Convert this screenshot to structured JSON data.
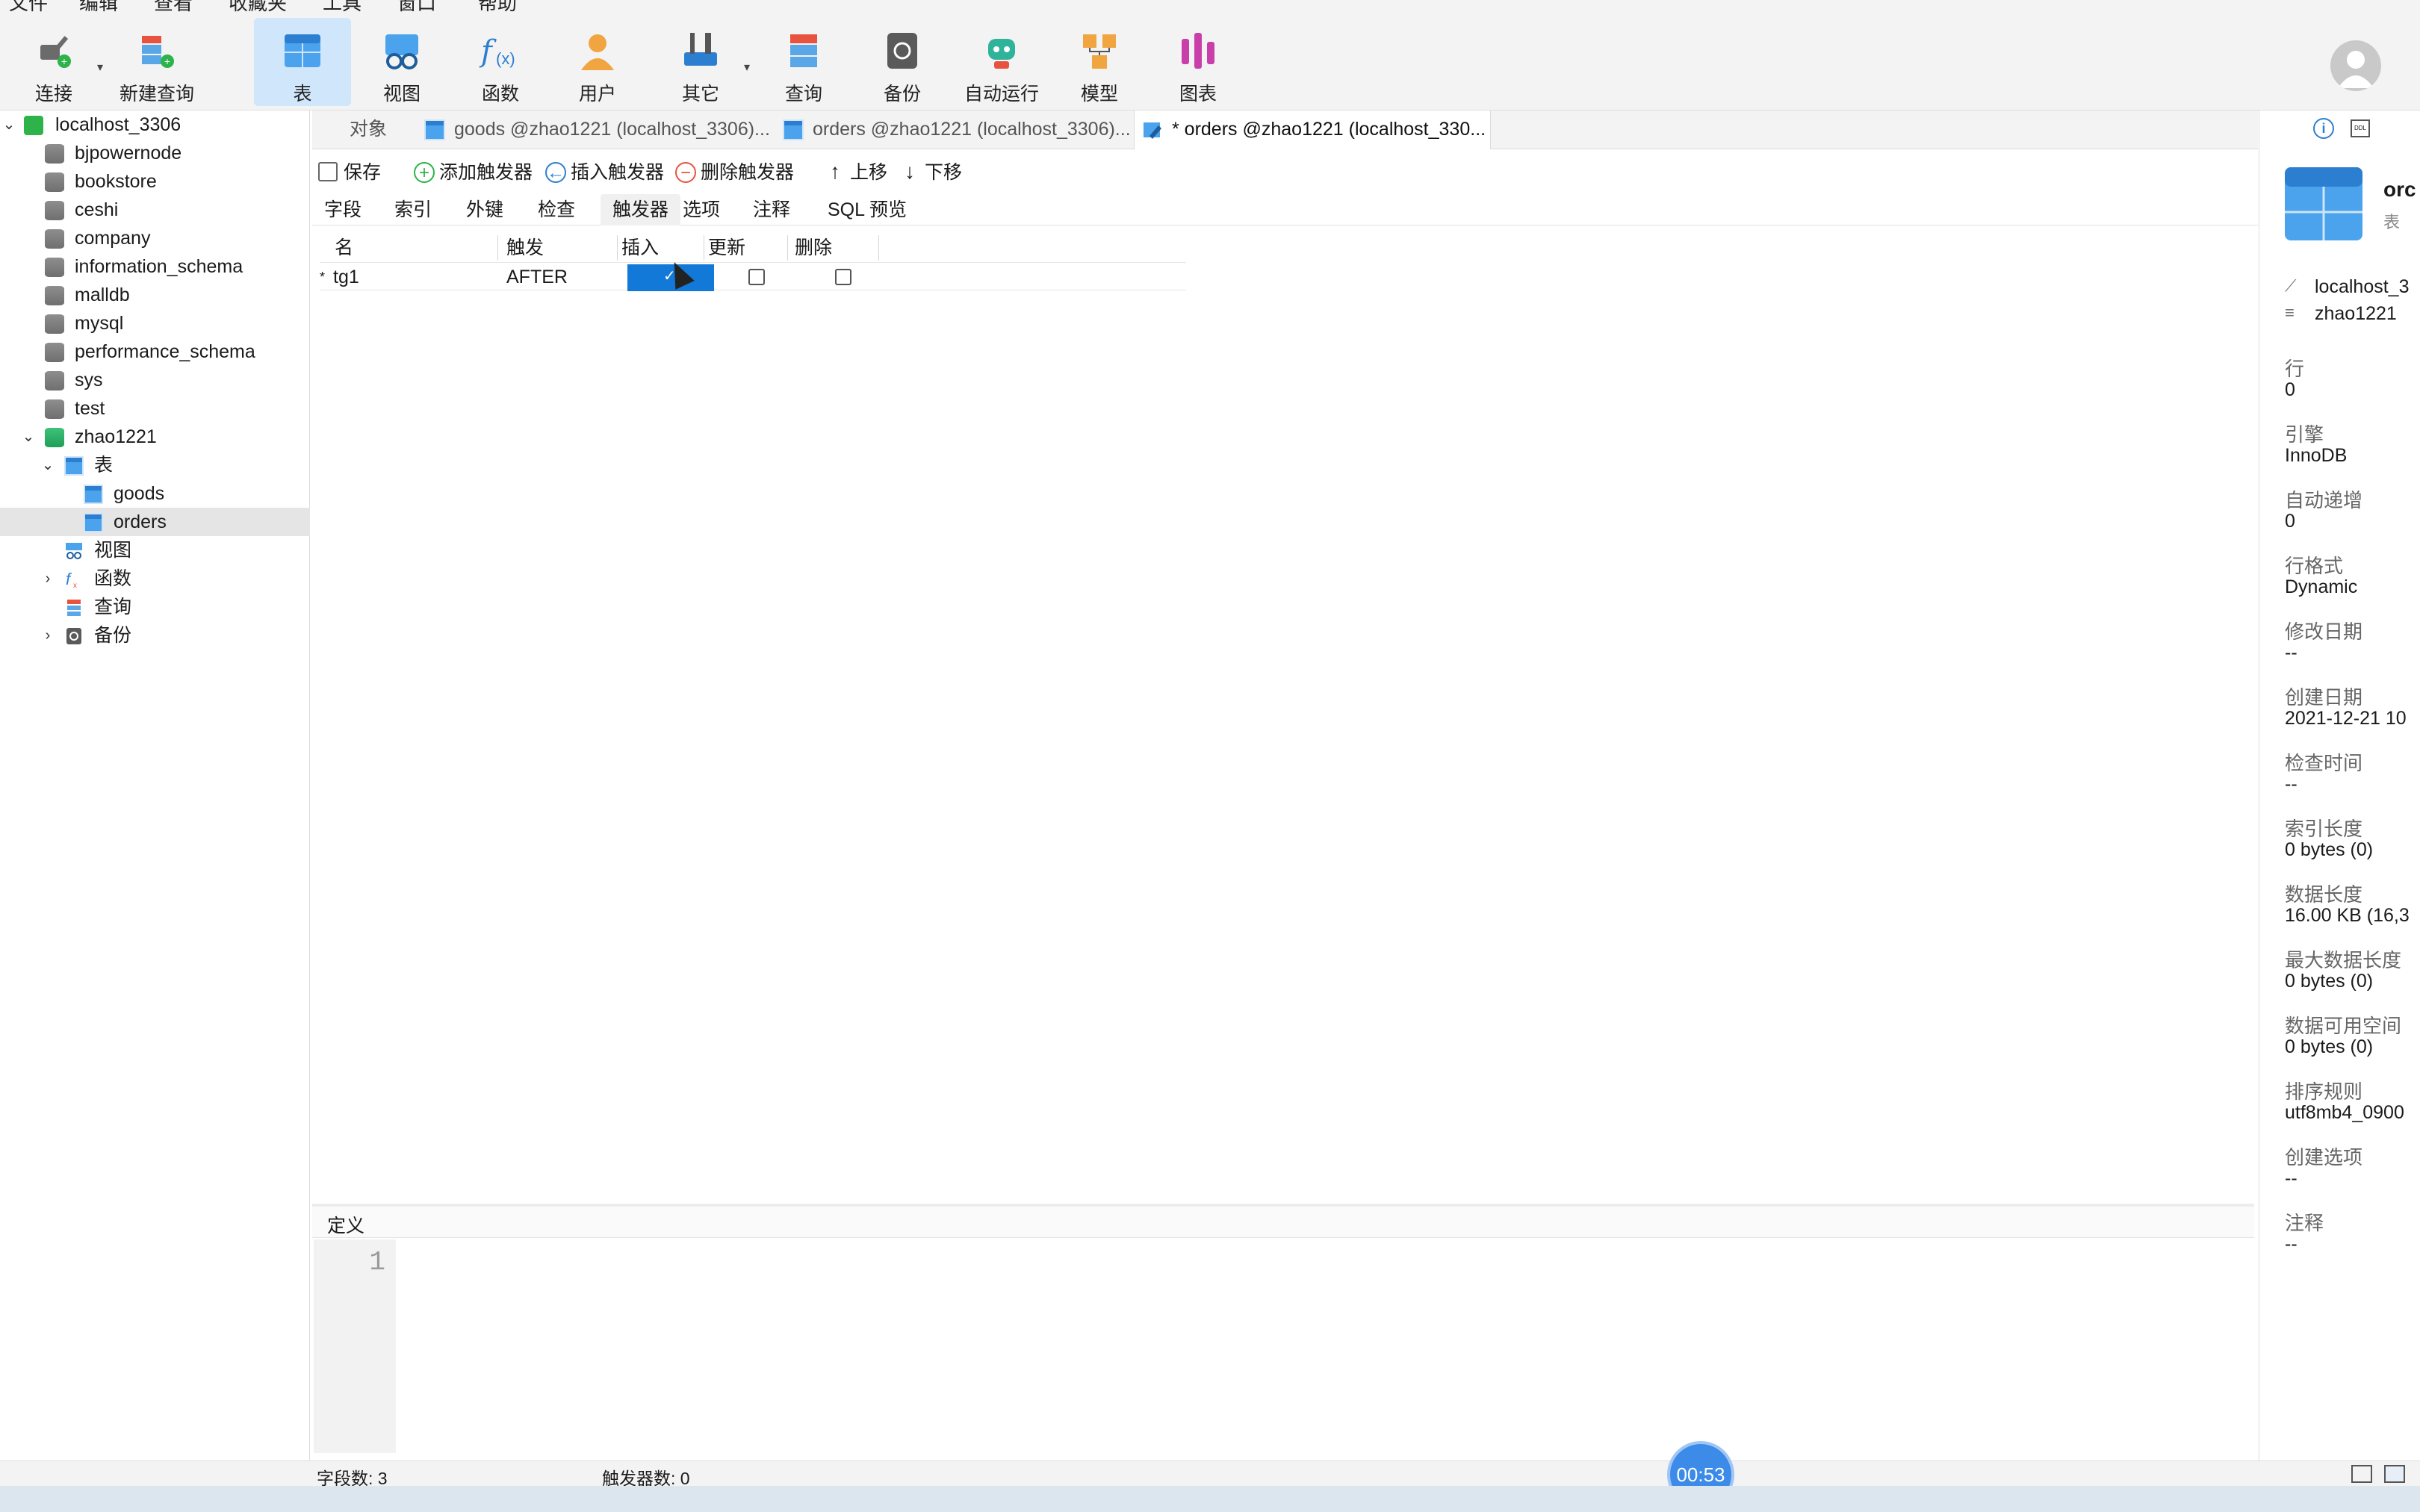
{
  "menu": [
    "文件",
    "编辑",
    "查看",
    "收藏夹",
    "工具",
    "窗口",
    "帮助"
  ],
  "toolbar": {
    "connect": "连接",
    "new_query": "新建查询",
    "table": "表",
    "view": "视图",
    "function": "函数",
    "user": "用户",
    "other": "其它",
    "query": "查询",
    "backup": "备份",
    "automation": "自动运行",
    "model": "模型",
    "chart": "图表"
  },
  "tree": {
    "connection": "localhost_3306",
    "databases": [
      "bjpowernode",
      "bookstore",
      "ceshi",
      "company",
      "information_schema",
      "malldb",
      "mysql",
      "performance_schema",
      "sys",
      "test"
    ],
    "open_db": "zhao1221",
    "tables_label": "表",
    "tables": [
      "goods",
      "orders"
    ],
    "views_label": "视图",
    "functions_label": "函数",
    "queries_label": "查询",
    "backups_label": "备份"
  },
  "tabs": {
    "objects": "对象",
    "tab1": "goods @zhao1221 (localhost_3306)...",
    "tab2": "orders @zhao1221 (localhost_3306)...",
    "tab3": "* orders @zhao1221 (localhost_330..."
  },
  "actions": {
    "save": "保存",
    "add_trigger": "添加触发器",
    "insert_trigger": "插入触发器",
    "delete_trigger": "删除触发器",
    "move_up": "上移",
    "move_down": "下移"
  },
  "subtabs": [
    "字段",
    "索引",
    "外键",
    "检查",
    "触发器",
    "选项",
    "注释",
    "SQL 预览"
  ],
  "grid": {
    "headers": {
      "name": "名",
      "fire": "触发",
      "insert": "插入",
      "update": "更新",
      "delete": "删除"
    },
    "row": {
      "marker": "*",
      "name": "tg1",
      "fire": "AFTER"
    }
  },
  "definition": {
    "label": "定义",
    "line1": "1"
  },
  "info": {
    "title": "orc",
    "subtitle": "表",
    "conn": "localhost_3",
    "db": "zhao1221",
    "rows_k": "行",
    "rows_v": "0",
    "engine_k": "引擎",
    "engine_v": "InnoDB",
    "autoinc_k": "自动递增",
    "autoinc_v": "0",
    "rowfmt_k": "行格式",
    "rowfmt_v": "Dynamic",
    "modified_k": "修改日期",
    "modified_v": "--",
    "created_k": "创建日期",
    "created_v": "2021-12-21 10",
    "check_k": "检查时间",
    "check_v": "--",
    "idxlen_k": "索引长度",
    "idxlen_v": "0 bytes (0)",
    "datalen_k": "数据长度",
    "datalen_v": "16.00 KB (16,3",
    "maxdata_k": "最大数据长度",
    "maxdata_v": "0 bytes (0)",
    "free_k": "数据可用空间",
    "free_v": "0 bytes (0)",
    "collation_k": "排序规则",
    "collation_v": "utf8mb4_0900",
    "createopt_k": "创建选项",
    "createopt_v": "--",
    "comment_k": "注释",
    "comment_v": "--"
  },
  "status": {
    "fields": "字段数: 3",
    "triggers": "触发器数: 0"
  },
  "timer": "00:53",
  "colors": {
    "accent": "#1279d8",
    "active_tab": "#cfe6fb",
    "timer": "#3c8be8"
  }
}
